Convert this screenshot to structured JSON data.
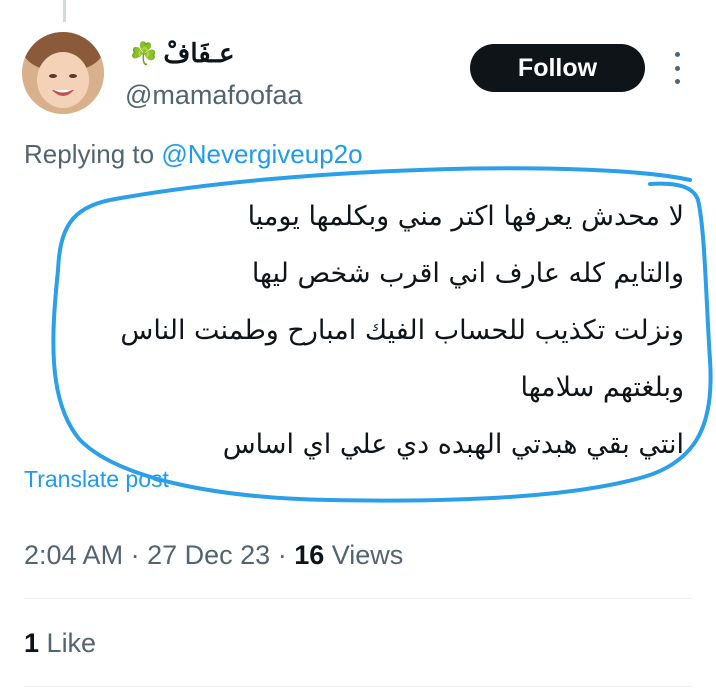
{
  "author": {
    "display_name": "عـفَافْ",
    "emoji": "☘️",
    "handle": "@mamafoofaa"
  },
  "follow_label": "Follow",
  "reply": {
    "prefix": "Replying to ",
    "target": "@Nevergiveup2o"
  },
  "tweet_lines": [
    "لا محدش يعرفها اكتر مني وبكلمها يوميا",
    "والتايم كله عارف اني اقرب شخص ليها",
    "ونزلت تكذيب للحساب الفيك امبارح وطمنت الناس",
    "وبلغتهم سلامها",
    "انتي بقي هبدتي الهبده دي علي اي اساس"
  ],
  "translate_label": "Translate post",
  "meta": {
    "time": "2:04 AM",
    "date": "27 Dec 23",
    "views_count": "16",
    "views_label": "Views"
  },
  "likes": {
    "count": "1",
    "label": "Like"
  },
  "colors": {
    "accent": "#1d9bf0",
    "annotation": "#2b9fe8",
    "text": "#0f1419",
    "secondary": "#536471"
  }
}
